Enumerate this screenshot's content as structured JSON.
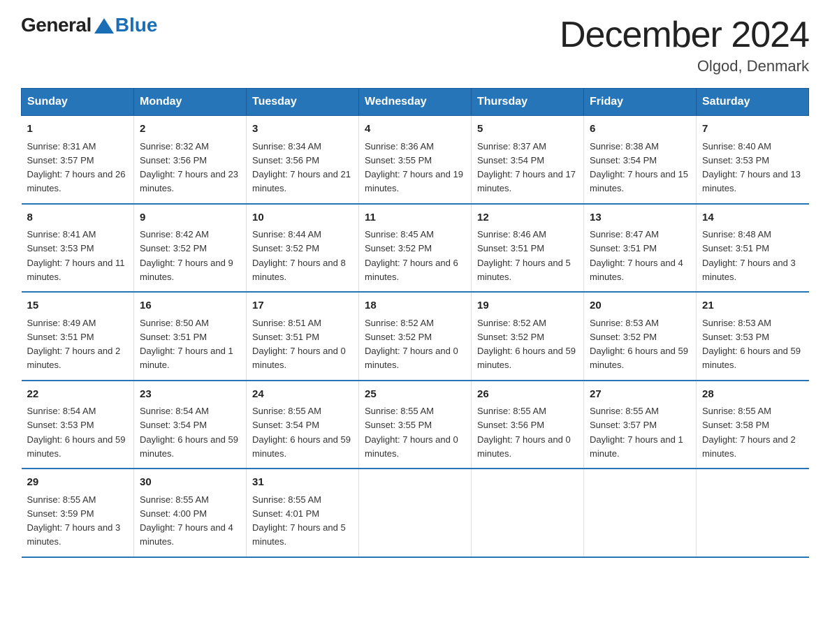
{
  "header": {
    "logo_general": "General",
    "logo_blue": "Blue",
    "title": "December 2024",
    "subtitle": "Olgod, Denmark"
  },
  "weekdays": [
    "Sunday",
    "Monday",
    "Tuesday",
    "Wednesday",
    "Thursday",
    "Friday",
    "Saturday"
  ],
  "weeks": [
    [
      {
        "day": "1",
        "sunrise": "8:31 AM",
        "sunset": "3:57 PM",
        "daylight": "7 hours and 26 minutes."
      },
      {
        "day": "2",
        "sunrise": "8:32 AM",
        "sunset": "3:56 PM",
        "daylight": "7 hours and 23 minutes."
      },
      {
        "day": "3",
        "sunrise": "8:34 AM",
        "sunset": "3:56 PM",
        "daylight": "7 hours and 21 minutes."
      },
      {
        "day": "4",
        "sunrise": "8:36 AM",
        "sunset": "3:55 PM",
        "daylight": "7 hours and 19 minutes."
      },
      {
        "day": "5",
        "sunrise": "8:37 AM",
        "sunset": "3:54 PM",
        "daylight": "7 hours and 17 minutes."
      },
      {
        "day": "6",
        "sunrise": "8:38 AM",
        "sunset": "3:54 PM",
        "daylight": "7 hours and 15 minutes."
      },
      {
        "day": "7",
        "sunrise": "8:40 AM",
        "sunset": "3:53 PM",
        "daylight": "7 hours and 13 minutes."
      }
    ],
    [
      {
        "day": "8",
        "sunrise": "8:41 AM",
        "sunset": "3:53 PM",
        "daylight": "7 hours and 11 minutes."
      },
      {
        "day": "9",
        "sunrise": "8:42 AM",
        "sunset": "3:52 PM",
        "daylight": "7 hours and 9 minutes."
      },
      {
        "day": "10",
        "sunrise": "8:44 AM",
        "sunset": "3:52 PM",
        "daylight": "7 hours and 8 minutes."
      },
      {
        "day": "11",
        "sunrise": "8:45 AM",
        "sunset": "3:52 PM",
        "daylight": "7 hours and 6 minutes."
      },
      {
        "day": "12",
        "sunrise": "8:46 AM",
        "sunset": "3:51 PM",
        "daylight": "7 hours and 5 minutes."
      },
      {
        "day": "13",
        "sunrise": "8:47 AM",
        "sunset": "3:51 PM",
        "daylight": "7 hours and 4 minutes."
      },
      {
        "day": "14",
        "sunrise": "8:48 AM",
        "sunset": "3:51 PM",
        "daylight": "7 hours and 3 minutes."
      }
    ],
    [
      {
        "day": "15",
        "sunrise": "8:49 AM",
        "sunset": "3:51 PM",
        "daylight": "7 hours and 2 minutes."
      },
      {
        "day": "16",
        "sunrise": "8:50 AM",
        "sunset": "3:51 PM",
        "daylight": "7 hours and 1 minute."
      },
      {
        "day": "17",
        "sunrise": "8:51 AM",
        "sunset": "3:51 PM",
        "daylight": "7 hours and 0 minutes."
      },
      {
        "day": "18",
        "sunrise": "8:52 AM",
        "sunset": "3:52 PM",
        "daylight": "7 hours and 0 minutes."
      },
      {
        "day": "19",
        "sunrise": "8:52 AM",
        "sunset": "3:52 PM",
        "daylight": "6 hours and 59 minutes."
      },
      {
        "day": "20",
        "sunrise": "8:53 AM",
        "sunset": "3:52 PM",
        "daylight": "6 hours and 59 minutes."
      },
      {
        "day": "21",
        "sunrise": "8:53 AM",
        "sunset": "3:53 PM",
        "daylight": "6 hours and 59 minutes."
      }
    ],
    [
      {
        "day": "22",
        "sunrise": "8:54 AM",
        "sunset": "3:53 PM",
        "daylight": "6 hours and 59 minutes."
      },
      {
        "day": "23",
        "sunrise": "8:54 AM",
        "sunset": "3:54 PM",
        "daylight": "6 hours and 59 minutes."
      },
      {
        "day": "24",
        "sunrise": "8:55 AM",
        "sunset": "3:54 PM",
        "daylight": "6 hours and 59 minutes."
      },
      {
        "day": "25",
        "sunrise": "8:55 AM",
        "sunset": "3:55 PM",
        "daylight": "7 hours and 0 minutes."
      },
      {
        "day": "26",
        "sunrise": "8:55 AM",
        "sunset": "3:56 PM",
        "daylight": "7 hours and 0 minutes."
      },
      {
        "day": "27",
        "sunrise": "8:55 AM",
        "sunset": "3:57 PM",
        "daylight": "7 hours and 1 minute."
      },
      {
        "day": "28",
        "sunrise": "8:55 AM",
        "sunset": "3:58 PM",
        "daylight": "7 hours and 2 minutes."
      }
    ],
    [
      {
        "day": "29",
        "sunrise": "8:55 AM",
        "sunset": "3:59 PM",
        "daylight": "7 hours and 3 minutes."
      },
      {
        "day": "30",
        "sunrise": "8:55 AM",
        "sunset": "4:00 PM",
        "daylight": "7 hours and 4 minutes."
      },
      {
        "day": "31",
        "sunrise": "8:55 AM",
        "sunset": "4:01 PM",
        "daylight": "7 hours and 5 minutes."
      },
      null,
      null,
      null,
      null
    ]
  ],
  "labels": {
    "sunrise": "Sunrise:",
    "sunset": "Sunset:",
    "daylight": "Daylight:"
  }
}
